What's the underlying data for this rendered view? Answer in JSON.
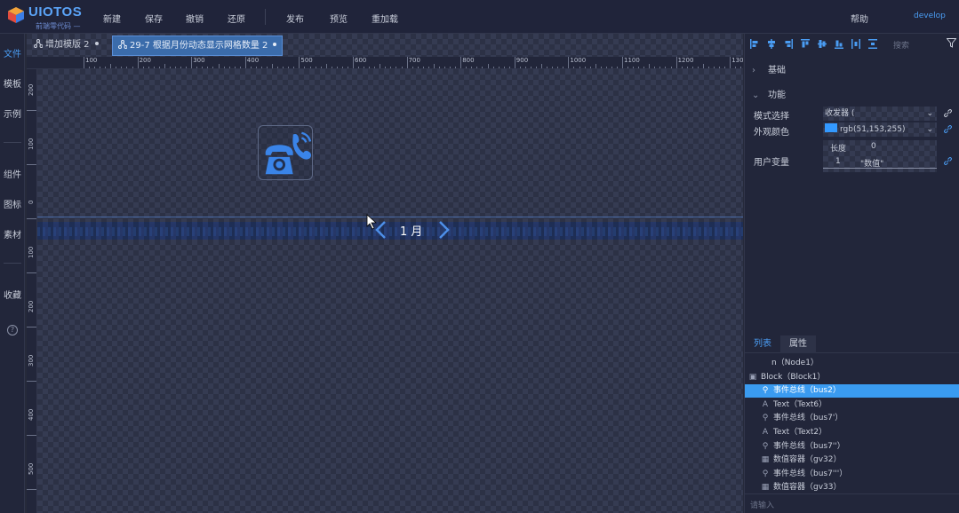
{
  "app": {
    "logo_name": "UIOTOS",
    "logo_slogan": "前端零代码 —",
    "help_label": "帮助",
    "branch_label": "develop"
  },
  "top_menu": {
    "new": "新建",
    "save": "保存",
    "undo": "撤销",
    "redo": "还原",
    "publish": "发布",
    "preview": "预览",
    "reload": "重加载"
  },
  "sidebar": {
    "file": "文件",
    "template": "模板",
    "example": "示例",
    "component": "组件",
    "icon": "图标",
    "material": "素材",
    "favorite": "收藏",
    "help_glyph": "?"
  },
  "tabs": [
    {
      "label": "增加模版 2"
    },
    {
      "label": "29-7 根据月份动态显示网格数量 2"
    }
  ],
  "ruler": {
    "top_labels": [
      "100",
      "200",
      "300",
      "400",
      "500",
      "600",
      "700",
      "800",
      "900",
      "1000",
      "1100",
      "1200",
      "130"
    ],
    "left_labels": [
      "200",
      "100",
      "0",
      "100",
      "200",
      "300",
      "400",
      "500"
    ]
  },
  "canvas": {
    "month_value": "1 月",
    "highlight_color": "#3399ff"
  },
  "right_panel": {
    "search_placeholder": "搜索",
    "section_basic": "基础",
    "section_function": "功能",
    "style_label": "模式选择",
    "style_value": "收发器 (",
    "color_label": "外观颜色",
    "color_value": "rgb(51,153,255)",
    "uservar_label": "用户变量",
    "uservar_len_label": "长度",
    "uservar_len_value": "0",
    "uservar_index": "1",
    "uservar_value": "\"数值\""
  },
  "layers": {
    "tab_list": "列表",
    "tab_props": "属性",
    "rows": [
      {
        "icon": "",
        "label": "n（Node1）",
        "indent": 30,
        "selected": false
      },
      {
        "icon": "folder",
        "label": "Block（Block1）",
        "indent": 18,
        "selected": false
      },
      {
        "icon": "bus",
        "label": "事件总线（bus2）",
        "indent": 32,
        "selected": true
      },
      {
        "icon": "A",
        "label": "Text（Text6）",
        "indent": 32,
        "selected": false
      },
      {
        "icon": "bus",
        "label": "事件总线（bus7'）",
        "indent": 32,
        "selected": false
      },
      {
        "icon": "A",
        "label": "Text（Text2）",
        "indent": 32,
        "selected": false
      },
      {
        "icon": "bus",
        "label": "事件总线（bus7''）",
        "indent": 32,
        "selected": false
      },
      {
        "icon": "grid",
        "label": "数值容器（gv32）",
        "indent": 32,
        "selected": false
      },
      {
        "icon": "bus",
        "label": "事件总线（bus7'''）",
        "indent": 32,
        "selected": false
      },
      {
        "icon": "grid",
        "label": "数值容器（gv33）",
        "indent": 32,
        "selected": false
      }
    ],
    "bottom_input_placeholder": "请输入"
  }
}
